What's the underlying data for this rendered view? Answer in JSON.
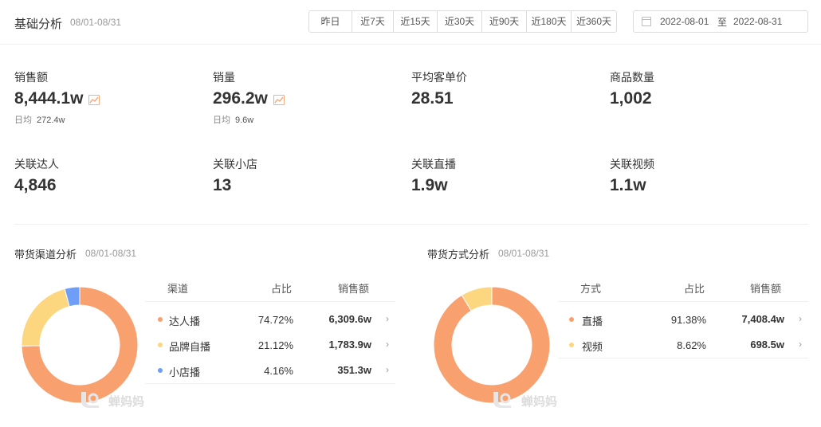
{
  "header": {
    "title": "基础分析",
    "date_range": "08/01-08/31",
    "range_buttons": [
      "昨日",
      "近7天",
      "近15天",
      "近30天",
      "近90天",
      "近180天",
      "近360天"
    ],
    "date_start": "2022-08-01",
    "date_sep": "至",
    "date_end": "2022-08-31"
  },
  "metrics": [
    {
      "label": "销售额",
      "value": "8,444.1w",
      "sub_label": "日均",
      "sub_value": "272.4w"
    },
    {
      "label": "销量",
      "value": "296.2w",
      "sub_label": "日均",
      "sub_value": "9.6w"
    },
    {
      "label": "平均客单价",
      "value": "28.51"
    },
    {
      "label": "商品数量",
      "value": "1,002"
    },
    {
      "label": "关联达人",
      "value": "4,846"
    },
    {
      "label": "关联小店",
      "value": "13"
    },
    {
      "label": "关联直播",
      "value": "1.9w"
    },
    {
      "label": "关联视频",
      "value": "1.1w"
    }
  ],
  "channel": {
    "title": "带货渠道分析",
    "date": "08/01-08/31",
    "headers": {
      "name": "渠道",
      "ratio": "占比",
      "sales": "销售额"
    },
    "rows": [
      {
        "name": "达人播",
        "ratio": "74.72%",
        "sales": "6,309.6w",
        "color": "#f9a06f"
      },
      {
        "name": "品牌自播",
        "ratio": "21.12%",
        "sales": "1,783.9w",
        "color": "#fdd77f"
      },
      {
        "name": "小店播",
        "ratio": "4.16%",
        "sales": "351.3w",
        "color": "#6f9ef8"
      }
    ]
  },
  "method": {
    "title": "带货方式分析",
    "date": "08/01-08/31",
    "headers": {
      "name": "方式",
      "ratio": "占比",
      "sales": "销售额"
    },
    "rows": [
      {
        "name": "直播",
        "ratio": "91.38%",
        "sales": "7,408.4w",
        "color": "#f9a06f"
      },
      {
        "name": "视频",
        "ratio": "8.62%",
        "sales": "698.5w",
        "color": "#fdd77f"
      }
    ]
  },
  "watermark": "蝉妈妈",
  "chart_data": [
    {
      "type": "pie",
      "categories": [
        "达人播",
        "品牌自播",
        "小店播"
      ],
      "values": [
        74.72,
        21.12,
        4.16
      ],
      "colors": [
        "#f9a06f",
        "#fdd77f",
        "#6f9ef8"
      ]
    },
    {
      "type": "pie",
      "categories": [
        "直播",
        "视频"
      ],
      "values": [
        91.38,
        8.62
      ],
      "colors": [
        "#f9a06f",
        "#fdd77f"
      ]
    }
  ]
}
